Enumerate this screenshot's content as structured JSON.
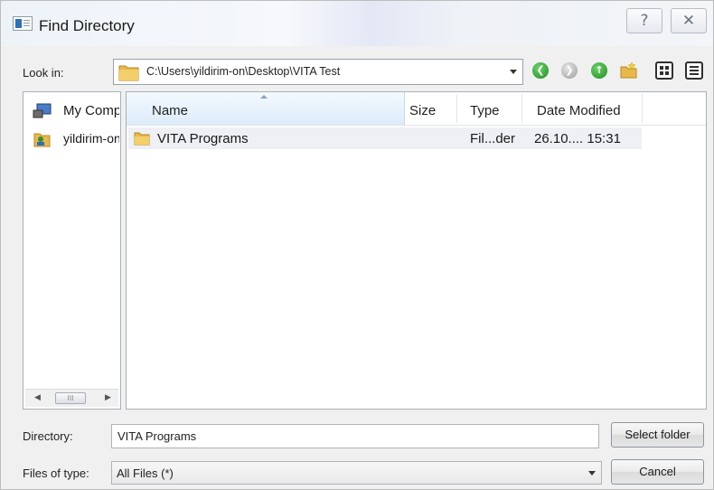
{
  "window": {
    "title": "Find Directory",
    "help_glyph": "?",
    "close_glyph": "✕"
  },
  "lookin": {
    "label": "Look in:",
    "path": "C:\\Users\\yildirim-on\\Desktop\\VITA Test"
  },
  "toolbar": {
    "back_icon": "back-arrow-icon",
    "forward_icon": "forward-arrow-icon",
    "up_icon": "parent-directory-icon",
    "new_folder_icon": "new-folder-icon",
    "list_view_icon": "list-view-icon",
    "detail_view_icon": "detail-view-icon"
  },
  "sidebar": {
    "items": [
      {
        "label": "My Computer",
        "icon": "computer-icon"
      },
      {
        "label": "yildirim-on",
        "icon": "user-folder-icon"
      }
    ],
    "scroll_thumb": "III"
  },
  "filelist": {
    "columns": [
      "Name",
      "Size",
      "Type",
      "Date Modified"
    ],
    "rows": [
      {
        "name": "VITA Programs",
        "size": "",
        "type": "Fil...der",
        "date": "26.10.... 15:31",
        "icon": "folder-icon"
      }
    ]
  },
  "form": {
    "directory_label": "Directory:",
    "directory_value": "VITA Programs",
    "filetype_label": "Files of type:",
    "filetype_value": "All Files (*)",
    "select_button": "Select folder",
    "cancel_button": "Cancel"
  },
  "colors": {
    "header_highlight": "#dcecfa",
    "selected_row": "#eef0f3",
    "folder": "#e8b84a",
    "nav_green": "#1e8a1e"
  }
}
